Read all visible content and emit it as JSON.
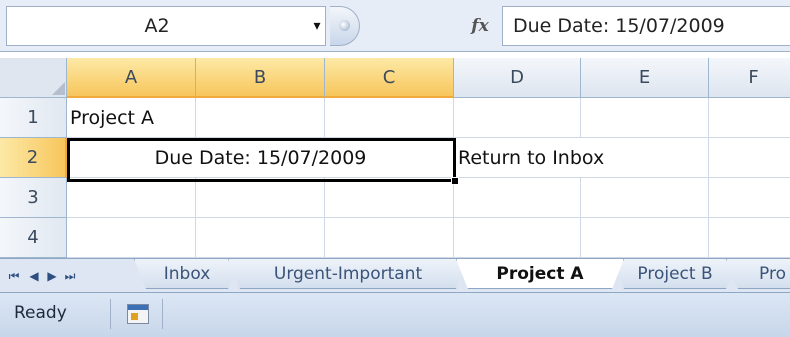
{
  "formula_bar": {
    "name_box": "A2",
    "dropdown_icon": "▾",
    "fx_icon": "fx",
    "formula": "Due Date: 15/07/2009"
  },
  "columns": [
    "A",
    "B",
    "C",
    "D",
    "E",
    "F"
  ],
  "rows": [
    "1",
    "2",
    "3",
    "4"
  ],
  "cells": {
    "A1": "Project A",
    "A2": "Due Date: 15/07/2009",
    "D2": "Return to Inbox"
  },
  "selection": {
    "cell": "A2",
    "columns": [
      "A",
      "B",
      "C"
    ],
    "row": "2"
  },
  "sheet_nav": [
    "⏮",
    "◀",
    "▶",
    "⏭"
  ],
  "sheet_tabs": [
    "Inbox",
    "Urgent-Important",
    "Project A",
    "Project B",
    "Pro"
  ],
  "active_tab": "Project A",
  "status": {
    "text": "Ready"
  },
  "colors": {
    "selected_header": "#f7c65c",
    "header": "#dde5ef",
    "grid_line": "#d0d7e5",
    "chrome": "#dde6f2"
  }
}
